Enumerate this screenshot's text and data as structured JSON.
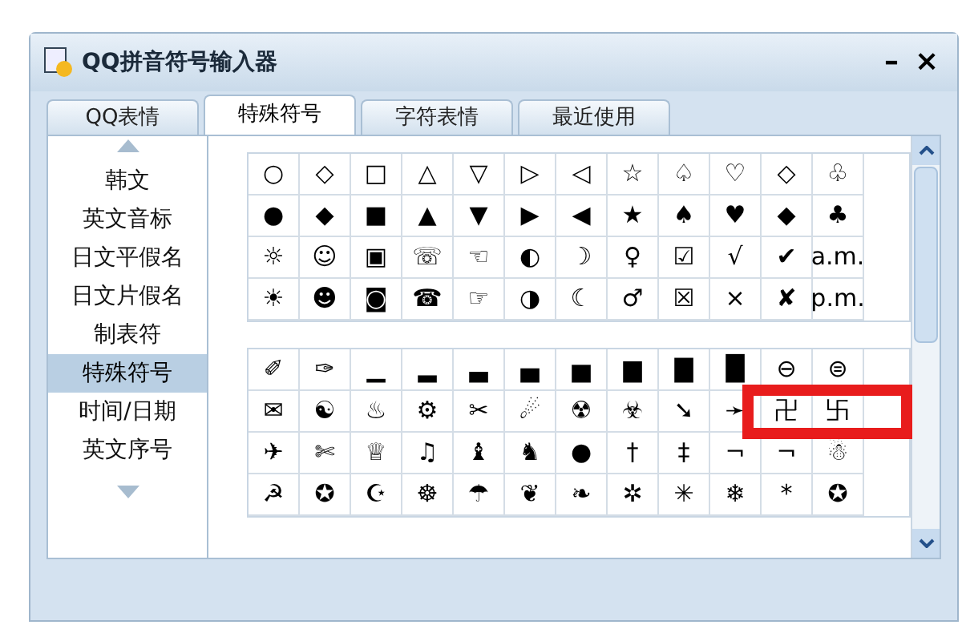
{
  "window": {
    "title": "QQ拼音符号输入器",
    "buttons": [
      "–",
      "×"
    ]
  },
  "tabs": [
    {
      "label": "QQ表情",
      "selected": false
    },
    {
      "label": "特殊符号",
      "selected": true
    },
    {
      "label": "字符表情",
      "selected": false
    },
    {
      "label": "最近使用",
      "selected": false
    }
  ],
  "sidebar": {
    "items": [
      {
        "label": "韩文",
        "selected": false
      },
      {
        "label": "英文音标",
        "selected": false
      },
      {
        "label": "日文平假名",
        "selected": false
      },
      {
        "label": "日文片假名",
        "selected": false
      },
      {
        "label": "制表符",
        "selected": false
      },
      {
        "label": "特殊符号",
        "selected": true
      },
      {
        "label": "时间/日期",
        "selected": false
      },
      {
        "label": "英文序号",
        "selected": false
      }
    ]
  },
  "grids": [
    {
      "rows": [
        [
          "○",
          "◇",
          "□",
          "△",
          "▽",
          "▷",
          "◁",
          "☆",
          "♤",
          "♡",
          "◇",
          "♧"
        ],
        [
          "●",
          "◆",
          "■",
          "▲",
          "▼",
          "▶",
          "◀",
          "★",
          "♠",
          "♥",
          "◆",
          "♣"
        ],
        [
          "☼",
          "☺",
          "▣",
          "☏",
          "☜",
          "◐",
          "☽",
          "♀",
          "☑",
          "√",
          "✔",
          "a.m."
        ],
        [
          "☀",
          "☻",
          "◙",
          "☎",
          "☞",
          "◑",
          "☾",
          "♂",
          "☒",
          "×",
          "✘",
          "p.m."
        ]
      ]
    },
    {
      "rows": [
        [
          "✐",
          "✑",
          "▁",
          "▂",
          "▃",
          "▄",
          "▅",
          "▆",
          "▇",
          "█",
          "⊖",
          "⊜"
        ],
        [
          "✉",
          "☯",
          "♨",
          "⚙",
          "✂",
          "☄",
          "☢",
          "☣",
          "➘",
          "➛",
          "卍",
          "卐"
        ],
        [
          "✈",
          "✄",
          "♕",
          "♫",
          "♝",
          "♞",
          "●",
          "†",
          "‡",
          "¬",
          "¬",
          "☃"
        ],
        [
          "☭",
          "✪",
          "☪",
          "☸",
          "☂",
          "❦",
          "❧",
          "✲",
          "✳",
          "❄",
          "*",
          "✪"
        ]
      ]
    }
  ],
  "highlight": {
    "kind": "box",
    "color": "#e81c1c"
  }
}
